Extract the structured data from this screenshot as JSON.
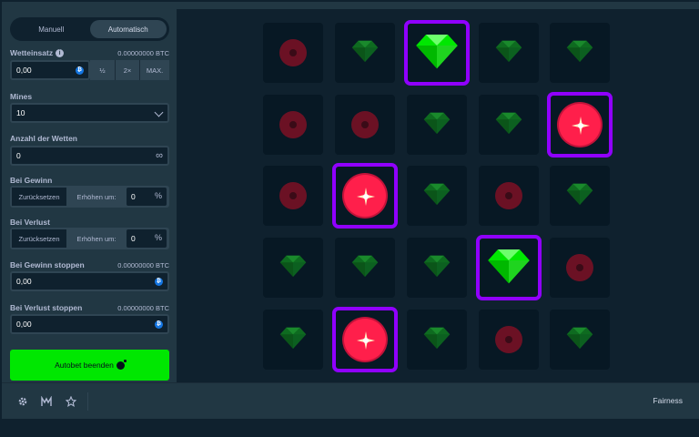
{
  "tabs": {
    "manual": "Manuell",
    "auto": "Automatisch"
  },
  "bet": {
    "label": "Wetteinsatz",
    "info": "i",
    "amount_btc": "0.00000000 BTC",
    "value": "0,00",
    "half": "½",
    "double": "2×",
    "max": "MAX."
  },
  "mines": {
    "label": "Mines",
    "value": "10"
  },
  "num_bets": {
    "label": "Anzahl der Wetten",
    "value": "0",
    "infinite": "∞"
  },
  "on_win": {
    "label": "Bei Gewinn",
    "reset": "Zurücksetzen",
    "increase": "Erhöhen um:",
    "value": "0",
    "pct": "%"
  },
  "on_loss": {
    "label": "Bei Verlust",
    "reset": "Zurücksetzen",
    "increase": "Erhöhen um:",
    "value": "0",
    "pct": "%"
  },
  "stop_profit": {
    "label": "Bei Gewinn stoppen",
    "amount_btc": "0.00000000 BTC",
    "value": "0,00"
  },
  "stop_loss": {
    "label": "Bei Verlust stoppen",
    "amount_btc": "0.00000000 BTC",
    "value": "0,00"
  },
  "autobet_button": "Autobet beenden",
  "coin_symbol": "₿",
  "footer": {
    "fairness": "Fairness",
    "icons": [
      "gear-icon",
      "chart-icon",
      "star-icon"
    ]
  },
  "board": {
    "rows": [
      [
        "mine",
        "gem",
        "gem-selected",
        "gem",
        "gem"
      ],
      [
        "mine",
        "mine",
        "gem",
        "gem",
        "mine-selected"
      ],
      [
        "mine",
        "mine-selected",
        "gem",
        "mine",
        "gem"
      ],
      [
        "gem",
        "gem",
        "gem",
        "gem-selected",
        "mine"
      ],
      [
        "gem",
        "mine-selected",
        "gem",
        "mine",
        "gem"
      ]
    ]
  },
  "colors": {
    "accent": "#00e701",
    "selected": "#9000ff",
    "mine": "#ff1f4b",
    "gem": "#00e701"
  }
}
